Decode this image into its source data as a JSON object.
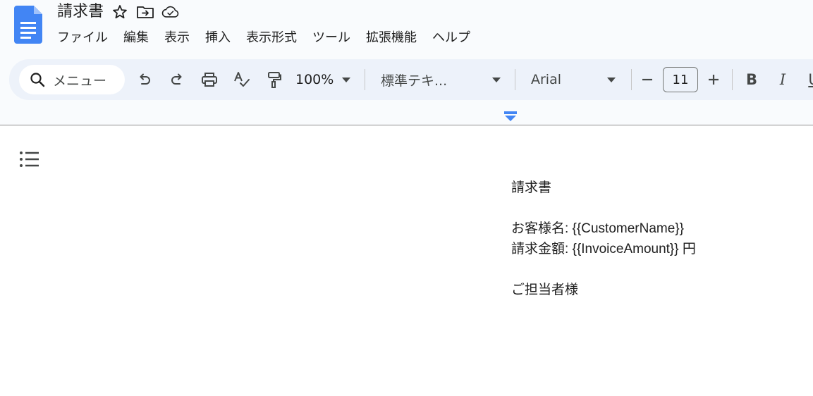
{
  "app": {
    "name": "Google Docs"
  },
  "document": {
    "title": "請求書"
  },
  "menu": {
    "items": [
      "ファイル",
      "編集",
      "表示",
      "挿入",
      "表示形式",
      "ツール",
      "拡張機能",
      "ヘルプ"
    ]
  },
  "toolbar": {
    "search_placeholder": "メニュー",
    "zoom": "100%",
    "paragraph_style": "標準テキ...",
    "font": "Arial",
    "font_size": "11",
    "bold_label": "B",
    "italic_label": "I",
    "underline_label": "U"
  },
  "body": {
    "lines": [
      "請求書",
      "",
      "お客様名: {{CustomerName}}",
      "請求金額: {{InvoiceAmount}} 円",
      "",
      "ご担当者様"
    ]
  },
  "colors": {
    "docs_blue": "#4285f4",
    "toolbar_bg": "#edf2fa",
    "app_bg": "#f9fbfd",
    "text": "#1f1f1f",
    "icon": "#444746"
  },
  "icons": [
    "docs-logo-icon",
    "star-icon",
    "move-to-folder-icon",
    "cloud-saved-icon",
    "search-icon",
    "undo-icon",
    "redo-icon",
    "print-icon",
    "spellcheck-icon",
    "paint-format-icon",
    "chevron-down-icon",
    "minus-icon",
    "plus-icon",
    "outline-list-icon",
    "indent-marker-icon"
  ]
}
